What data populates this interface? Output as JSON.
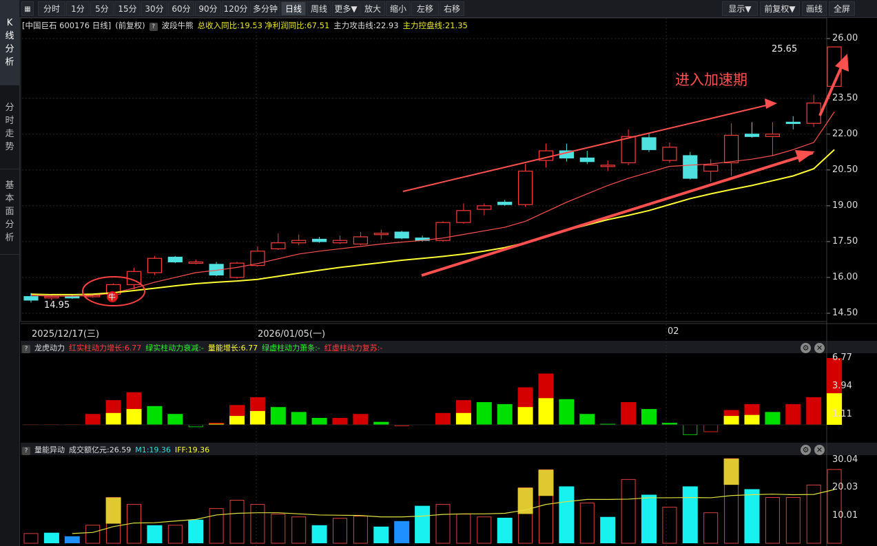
{
  "sidebar": {
    "tabs": [
      {
        "label": "K线分析",
        "chars": [
          "K",
          "线",
          "分",
          "析"
        ],
        "active": true
      },
      {
        "label": "分时走势",
        "chars": [
          "分",
          "时",
          "走",
          "势"
        ],
        "active": false
      },
      {
        "label": "基本面分析",
        "chars": [
          "基",
          "本",
          "面",
          "分",
          "析"
        ],
        "active": false
      }
    ]
  },
  "toolbar": {
    "periods": [
      "分时",
      "1分",
      "5分",
      "15分",
      "30分",
      "60分",
      "90分",
      "120分",
      "多分钟",
      "日线",
      "周线",
      "更多▼",
      "放大",
      "缩小",
      "左移",
      "右移"
    ],
    "selected": "日线",
    "right": [
      "显示▼",
      "前复权▼",
      "画线",
      "全屏"
    ]
  },
  "main_chart": {
    "stock": "[中国巨石 600176 日线]",
    "adjust": "(前复权)",
    "indicator": "波段牛熊",
    "metric1": "总收入同比:19.53",
    "metric2": "净利润同比:67.51",
    "attack_line": "主力攻击线:22.93",
    "control_line": "主力控盘线:21.35",
    "y_ticks": [
      "26.00",
      "23.50",
      "22.00",
      "20.50",
      "19.00",
      "17.50",
      "16.00",
      "14.50"
    ],
    "high_label": "25.65",
    "low_label": "14.95",
    "annotation": "进入加速期",
    "bull_marker": "牛",
    "dates": [
      "2025/12/17(三)",
      "2026/01/05(一)",
      "02"
    ]
  },
  "panel1": {
    "name": "龙虎动力",
    "l1": "红实柱动力增长:6.77",
    "l2": "绿实柱动力衰减:-",
    "l3": "量能增长:6.77",
    "l4": "绿虚柱动力萧条:-",
    "l5": "红虚柱动力复苏:-",
    "y_ticks": [
      "6.77",
      "3.94",
      "1.11"
    ]
  },
  "panel2": {
    "name": "量能异动",
    "l1": "成交额亿元:26.59",
    "l2": "M1:19.36",
    "l3": "IFF:19.36",
    "y_ticks": [
      "30.04",
      "20.03",
      "10.01"
    ]
  },
  "colors": {
    "up": "#ff3b3b",
    "down": "#4fe0e0",
    "ma_red": "#ff5050",
    "ma_yellow": "#ffff33",
    "grid": "#2a2a2a"
  },
  "chart_data": {
    "type": "candlestick",
    "candles": [
      {
        "o": 15.2,
        "h": 15.35,
        "l": 14.95,
        "c": 15.05
      },
      {
        "o": 15.15,
        "h": 15.3,
        "l": 15.05,
        "c": 15.2
      },
      {
        "o": 15.2,
        "h": 15.3,
        "l": 15.1,
        "c": 15.18
      },
      {
        "o": 15.2,
        "h": 15.28,
        "l": 15.15,
        "c": 15.25
      },
      {
        "o": 15.3,
        "h": 15.75,
        "l": 15.25,
        "c": 15.7
      },
      {
        "o": 15.7,
        "h": 16.4,
        "l": 15.5,
        "c": 16.25
      },
      {
        "o": 16.2,
        "h": 16.9,
        "l": 16.1,
        "c": 16.8
      },
      {
        "o": 16.85,
        "h": 16.9,
        "l": 16.6,
        "c": 16.65
      },
      {
        "o": 16.65,
        "h": 16.75,
        "l": 16.55,
        "c": 16.65
      },
      {
        "o": 16.55,
        "h": 16.65,
        "l": 16.05,
        "c": 16.1
      },
      {
        "o": 16.0,
        "h": 16.65,
        "l": 15.95,
        "c": 16.6
      },
      {
        "o": 16.5,
        "h": 17.3,
        "l": 16.45,
        "c": 17.1
      },
      {
        "o": 17.2,
        "h": 17.85,
        "l": 17.15,
        "c": 17.45
      },
      {
        "o": 17.45,
        "h": 17.8,
        "l": 17.35,
        "c": 17.55
      },
      {
        "o": 17.6,
        "h": 17.7,
        "l": 17.45,
        "c": 17.5
      },
      {
        "o": 17.45,
        "h": 17.75,
        "l": 17.4,
        "c": 17.55
      },
      {
        "o": 17.4,
        "h": 17.9,
        "l": 17.35,
        "c": 17.7
      },
      {
        "o": 17.8,
        "h": 18.0,
        "l": 17.6,
        "c": 17.85
      },
      {
        "o": 17.9,
        "h": 17.95,
        "l": 17.6,
        "c": 17.65
      },
      {
        "o": 17.65,
        "h": 17.75,
        "l": 17.5,
        "c": 17.55
      },
      {
        "o": 17.55,
        "h": 18.35,
        "l": 17.5,
        "c": 18.3
      },
      {
        "o": 18.3,
        "h": 19.1,
        "l": 18.25,
        "c": 18.8
      },
      {
        "o": 18.85,
        "h": 19.1,
        "l": 18.6,
        "c": 19.0
      },
      {
        "o": 19.15,
        "h": 19.25,
        "l": 19.0,
        "c": 19.05
      },
      {
        "o": 19.05,
        "h": 20.75,
        "l": 18.95,
        "c": 20.45
      },
      {
        "o": 20.9,
        "h": 21.6,
        "l": 20.6,
        "c": 21.3
      },
      {
        "o": 21.3,
        "h": 21.6,
        "l": 20.85,
        "c": 21.0
      },
      {
        "o": 21.0,
        "h": 21.3,
        "l": 20.75,
        "c": 20.85
      },
      {
        "o": 20.65,
        "h": 20.9,
        "l": 20.45,
        "c": 20.7
      },
      {
        "o": 20.8,
        "h": 22.2,
        "l": 20.7,
        "c": 21.9
      },
      {
        "o": 21.85,
        "h": 22.05,
        "l": 21.25,
        "c": 21.35
      },
      {
        "o": 20.9,
        "h": 21.65,
        "l": 20.8,
        "c": 21.45
      },
      {
        "o": 21.1,
        "h": 21.25,
        "l": 20.1,
        "c": 20.15
      },
      {
        "o": 20.45,
        "h": 20.95,
        "l": 20.0,
        "c": 20.7
      },
      {
        "o": 20.8,
        "h": 22.45,
        "l": 20.25,
        "c": 21.95
      },
      {
        "o": 22.0,
        "h": 22.5,
        "l": 21.85,
        "c": 21.9
      },
      {
        "o": 21.9,
        "h": 22.5,
        "l": 21.1,
        "c": 22.0
      },
      {
        "o": 22.5,
        "h": 22.75,
        "l": 22.2,
        "c": 22.45
      },
      {
        "o": 22.45,
        "h": 23.65,
        "l": 22.3,
        "c": 23.3
      },
      {
        "o": 24.0,
        "h": 25.65,
        "l": 24.0,
        "c": 25.65
      }
    ],
    "ma_red": [
      15.25,
      15.22,
      15.22,
      15.24,
      15.35,
      15.55,
      15.8,
      16.0,
      16.2,
      16.3,
      16.42,
      16.58,
      16.78,
      16.98,
      17.1,
      17.2,
      17.3,
      17.4,
      17.48,
      17.55,
      17.65,
      17.8,
      17.95,
      18.1,
      18.35,
      18.75,
      19.15,
      19.5,
      19.85,
      20.15,
      20.4,
      20.65,
      20.7,
      20.75,
      20.85,
      20.95,
      21.1,
      21.35,
      21.65,
      22.93
    ],
    "ma_yellow": [
      15.3,
      15.28,
      15.28,
      15.3,
      15.36,
      15.45,
      15.55,
      15.65,
      15.74,
      15.8,
      15.85,
      15.92,
      16.05,
      16.18,
      16.3,
      16.42,
      16.52,
      16.62,
      16.72,
      16.8,
      16.88,
      16.98,
      17.1,
      17.25,
      17.45,
      17.72,
      17.98,
      18.2,
      18.42,
      18.6,
      18.8,
      19.05,
      19.3,
      19.5,
      19.68,
      19.85,
      20.05,
      20.25,
      20.55,
      21.35
    ],
    "panel1_values": [
      0.05,
      0.05,
      0.05,
      1.1,
      2.5,
      3.3,
      1.9,
      1.1,
      -0.2,
      0.2,
      2.0,
      2.8,
      1.8,
      1.3,
      0.7,
      0.7,
      1.1,
      0.3,
      -0.1,
      0,
      1.2,
      2.5,
      2.3,
      2.1,
      3.8,
      5.2,
      2.6,
      1.1,
      0.1,
      2.3,
      1.6,
      0.2,
      -1.0,
      -0.7,
      1.5,
      2.1,
      1.3,
      2.1,
      2.8,
      6.77
    ],
    "panel1_yellow": [
      0,
      0,
      0,
      0,
      1.2,
      1.6,
      0,
      0,
      0,
      0.1,
      0.9,
      1.4,
      0,
      0,
      0,
      0,
      0,
      0,
      0,
      0,
      0,
      1.2,
      0,
      0,
      1.8,
      2.7,
      0,
      0,
      0,
      0,
      0,
      0,
      0,
      0,
      0.9,
      1.0,
      0,
      0,
      0,
      3.2
    ],
    "panel2_values": [
      3.5,
      3.8,
      2.5,
      6.5,
      16.5,
      14,
      6.5,
      6.5,
      8.5,
      12.5,
      15.5,
      14,
      10.5,
      9.5,
      6.5,
      9,
      9.8,
      6,
      8,
      13.5,
      14,
      10.5,
      9.5,
      9.2,
      20,
      26.5,
      20.5,
      14.5,
      9.5,
      23,
      17.5,
      13,
      20.5,
      11,
      30.5,
      19.5,
      16.5,
      16.5,
      21,
      26.59
    ],
    "m1": [
      null,
      null,
      3.5,
      3.9,
      6.0,
      7.3,
      7.4,
      8.0,
      8.6,
      10.2,
      10.8,
      11.0,
      11.0,
      10.6,
      10.2,
      10.1,
      10.0,
      9.5,
      9.5,
      9.8,
      10.4,
      10.6,
      10.6,
      10.8,
      12.0,
      14.0,
      15.0,
      15.8,
      15.8,
      15.9,
      16.4,
      16.4,
      16.5,
      16.4,
      17.2,
      17.5,
      17.7,
      17.5,
      17.6,
      19.36
    ]
  }
}
